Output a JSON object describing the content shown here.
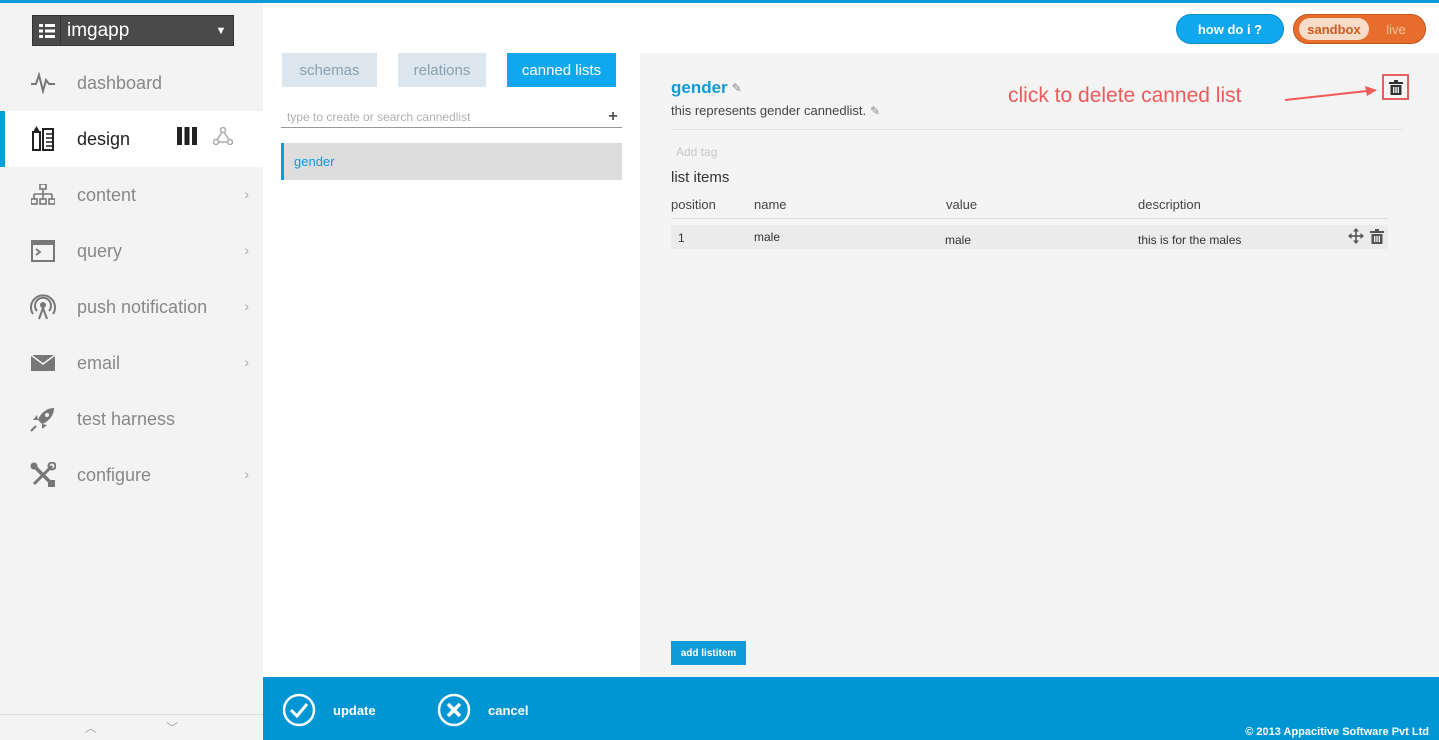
{
  "app": {
    "name": "imgapp"
  },
  "sidebar": {
    "items": [
      {
        "label": "dashboard",
        "icon": "pulse-icon",
        "active": false,
        "chevron": false
      },
      {
        "label": "design",
        "icon": "design-icon",
        "active": true,
        "chevron": false
      },
      {
        "label": "content",
        "icon": "sitemap-icon",
        "active": false,
        "chevron": true
      },
      {
        "label": "query",
        "icon": "terminal-icon",
        "active": false,
        "chevron": true
      },
      {
        "label": "push notification",
        "icon": "broadcast-icon",
        "active": false,
        "chevron": true
      },
      {
        "label": "email",
        "icon": "envelope-icon",
        "active": false,
        "chevron": true
      },
      {
        "label": "test harness",
        "icon": "rocket-icon",
        "active": false,
        "chevron": false
      },
      {
        "label": "configure",
        "icon": "tools-icon",
        "active": false,
        "chevron": true
      }
    ]
  },
  "topbar": {
    "help_label": "how do i ?",
    "env_sandbox": "sandbox",
    "env_live": "live"
  },
  "tabs": [
    {
      "label": "schemas"
    },
    {
      "label": "relations"
    },
    {
      "label": "canned lists"
    }
  ],
  "search": {
    "placeholder": "type to create or search cannedlist"
  },
  "cannedlists": [
    {
      "name": "gender"
    }
  ],
  "detail": {
    "title": "gender",
    "description": "this represents gender cannedlist.",
    "tag_placeholder": "Add tag",
    "annotation": "click to delete canned list",
    "items_heading": "list items",
    "columns": [
      "position",
      "name",
      "value",
      "description"
    ],
    "rows": [
      {
        "position": "1",
        "name": "male",
        "value": "male",
        "description": "this is for the males"
      }
    ],
    "add_button": "add listitem"
  },
  "footer": {
    "update_label": "update",
    "cancel_label": "cancel",
    "copyright": "© 2013 Appacitive Software Pvt Ltd"
  },
  "colors": {
    "accent": "#0f9bd7",
    "sandbox": "#e66d2c",
    "annotation": "#f05a5a"
  }
}
